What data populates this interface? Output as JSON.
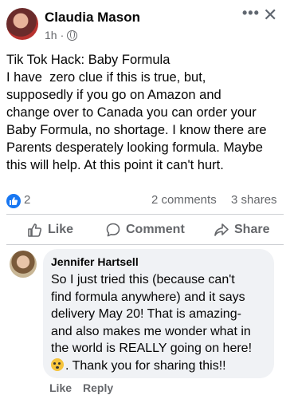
{
  "post": {
    "author": "Claudia Mason",
    "time": "1h",
    "meta_separator": "·",
    "more_label": "•••",
    "close_label": "✕",
    "lines": [
      "Tik Tok Hack: Baby Formula",
      "I have  zero clue if this is true, but,",
      "supposedly if you go on Amazon and",
      "change over to Canada you can order your",
      "Baby Formula, no shortage. I know there are",
      "Parents desperately looking formula. Maybe",
      "this will help. At this point it can't hurt."
    ]
  },
  "stats": {
    "reactions": "2",
    "comments": "2 comments",
    "shares": "3 shares"
  },
  "actions": {
    "like": "Like",
    "comment": "Comment",
    "share": "Share"
  },
  "comment": {
    "author": "Jennifer Hartsell",
    "lines": [
      "So I just tried this (because can't",
      "find formula anywhere) and it says",
      "delivery May 20! That is amazing-",
      "and also makes me wonder what in",
      "the world is REALLY going on here!"
    ],
    "last_line": ". Thank you for sharing this!!",
    "like_label": "Like",
    "reply_label": "Reply"
  },
  "colors": {
    "accent": "#1877f2",
    "muted": "#65676b",
    "bubble": "#f0f2f5"
  }
}
